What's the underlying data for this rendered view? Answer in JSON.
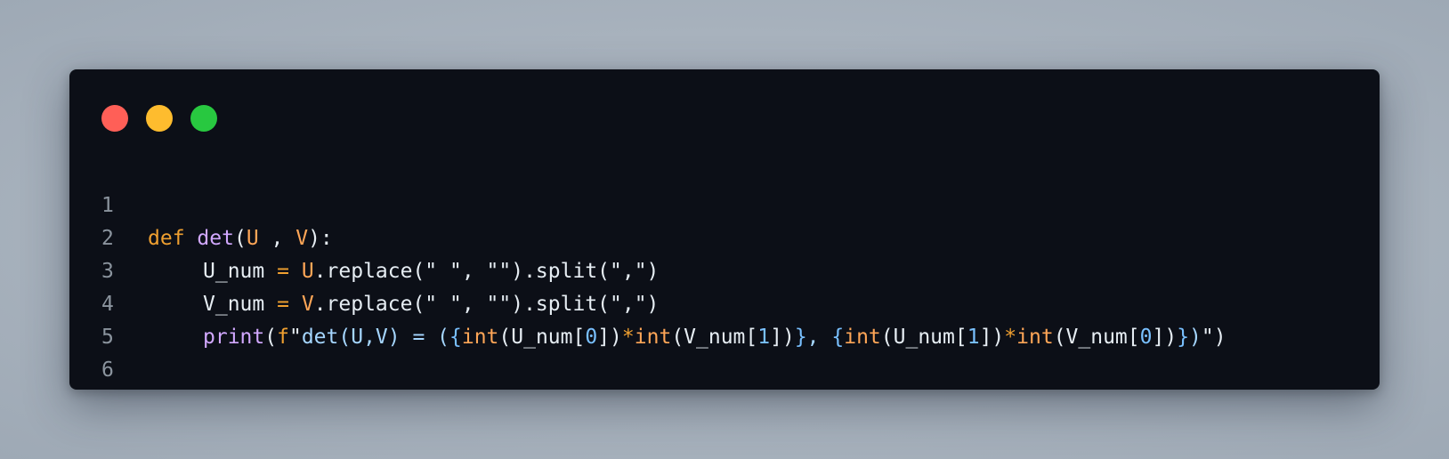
{
  "window": {
    "controls": [
      "close",
      "minimize",
      "maximize"
    ],
    "colors": {
      "close": "#ff5f57",
      "minimize": "#febc2e",
      "maximize": "#28c840",
      "background": "#0c0f17"
    }
  },
  "code": {
    "language": "python",
    "line_numbers": [
      "1",
      "2",
      "3",
      "4",
      "5",
      "6"
    ],
    "lines": [
      "def det(U , V):",
      "    U_num = U.replace(\" \", \"\").split(\",\")",
      "    V_num = V.replace(\" \", \"\").split(\",\")",
      "    print(f\"det(U,V) = ({int(U_num[0])*int(V_num[1])}, {int(U_num[1])*int(V_num[0])})\")",
      "",
      ""
    ],
    "tokens": {
      "l1": {
        "kw": "def",
        "fn": "det",
        "open": "(",
        "p1": "U",
        "sep": " , ",
        "p2": "V",
        "close": "):"
      },
      "l2": {
        "var": "U_num",
        "eq": "=",
        "obj": "U",
        "rest": ".replace(\" \", \"\").split(\",\")"
      },
      "l3": {
        "var": "V_num",
        "eq": "=",
        "obj": "V",
        "rest": ".replace(\" \", \"\").split(\",\")"
      },
      "l4": {
        "fn": "print",
        "open": "(",
        "prefix": "f",
        "q": "\"",
        "lit1": "det(U,V) = (",
        "b1": "{",
        "int1": "int",
        "a1": "(U_num[",
        "n1": "0",
        "c1": "])",
        "mul1": "*",
        "int2": "int",
        "a2": "(V_num[",
        "n2": "1",
        "c2": "])",
        "b2": "}",
        "lit2": ", ",
        "b3": "{",
        "int3": "int",
        "a3": "(U_num[",
        "n3": "1",
        "c3": "])",
        "mul2": "*",
        "int4": "int",
        "a4": "(V_num[",
        "n4": "0",
        "c4": "])",
        "b4": "}",
        "lit3": ")",
        "q2": "\"",
        "close": ")"
      }
    }
  }
}
